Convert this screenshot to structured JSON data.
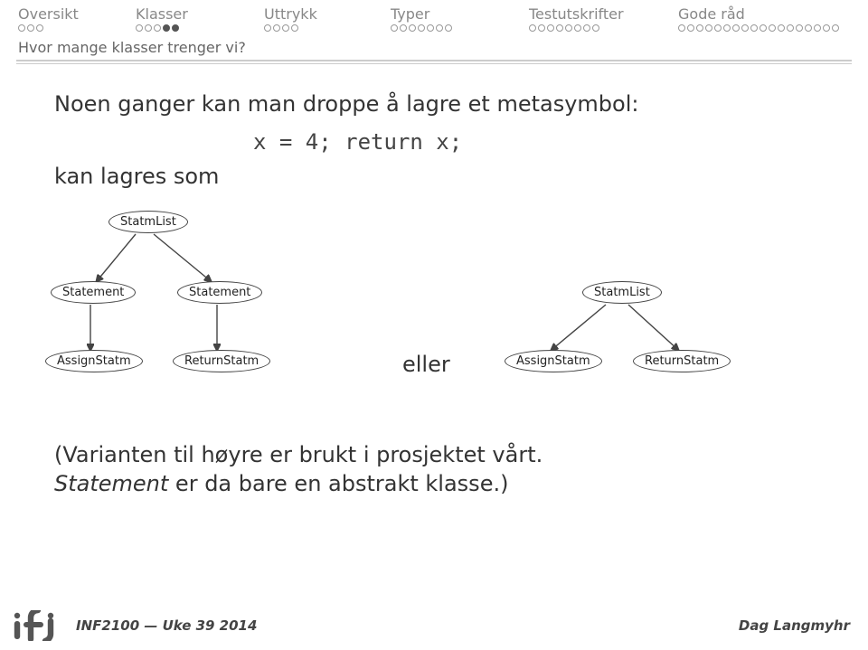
{
  "nav": {
    "items": [
      {
        "label": "Oversikt",
        "dots": 3,
        "filled": []
      },
      {
        "label": "Klasser",
        "dots": 5,
        "filled": [
          3,
          4
        ]
      },
      {
        "label": "Uttrykk",
        "dots": 4,
        "filled": []
      },
      {
        "label": "Typer",
        "dots": 7,
        "filled": []
      },
      {
        "label": "Testutskrifter",
        "dots": 8,
        "filled": []
      },
      {
        "label": "Gode råd",
        "dots": 18,
        "filled": []
      }
    ]
  },
  "subtitle": "Hvor mange klasser trenger vi?",
  "intro": "Noen ganger kan man droppe å lagre et metasymbol:",
  "code": "x = 4; return x;",
  "stored": "kan lagres som",
  "diagram_left": {
    "root": "StatmList",
    "mid_left": "Statement",
    "mid_right": "Statement",
    "leaf_left": "AssignStatm",
    "leaf_right": "ReturnStatm"
  },
  "middle": "eller",
  "diagram_right": {
    "root": "StatmList",
    "leaf_left": "AssignStatm",
    "leaf_right": "ReturnStatm"
  },
  "outro_line1_a": "(Varianten til høyre er brukt i prosjektet vårt.",
  "outro_line2_a": "Statement",
  "outro_line2_b": " er da bare en abstrakt klasse.)",
  "footer": {
    "course": "INF2100 — Uke 39 2014",
    "author": "Dag Langmyhr"
  },
  "chart_data": [
    {
      "type": "table",
      "title": "Parse tree (left variant)",
      "nodes": [
        "StatmList",
        "Statement",
        "Statement",
        "AssignStatm",
        "ReturnStatm"
      ],
      "edges": [
        [
          "StatmList",
          "Statement"
        ],
        [
          "StatmList",
          "Statement"
        ],
        [
          "Statement",
          "AssignStatm"
        ],
        [
          "Statement",
          "ReturnStatm"
        ]
      ]
    },
    {
      "type": "table",
      "title": "Parse tree (right variant)",
      "nodes": [
        "StatmList",
        "AssignStatm",
        "ReturnStatm"
      ],
      "edges": [
        [
          "StatmList",
          "AssignStatm"
        ],
        [
          "StatmList",
          "ReturnStatm"
        ]
      ]
    }
  ]
}
